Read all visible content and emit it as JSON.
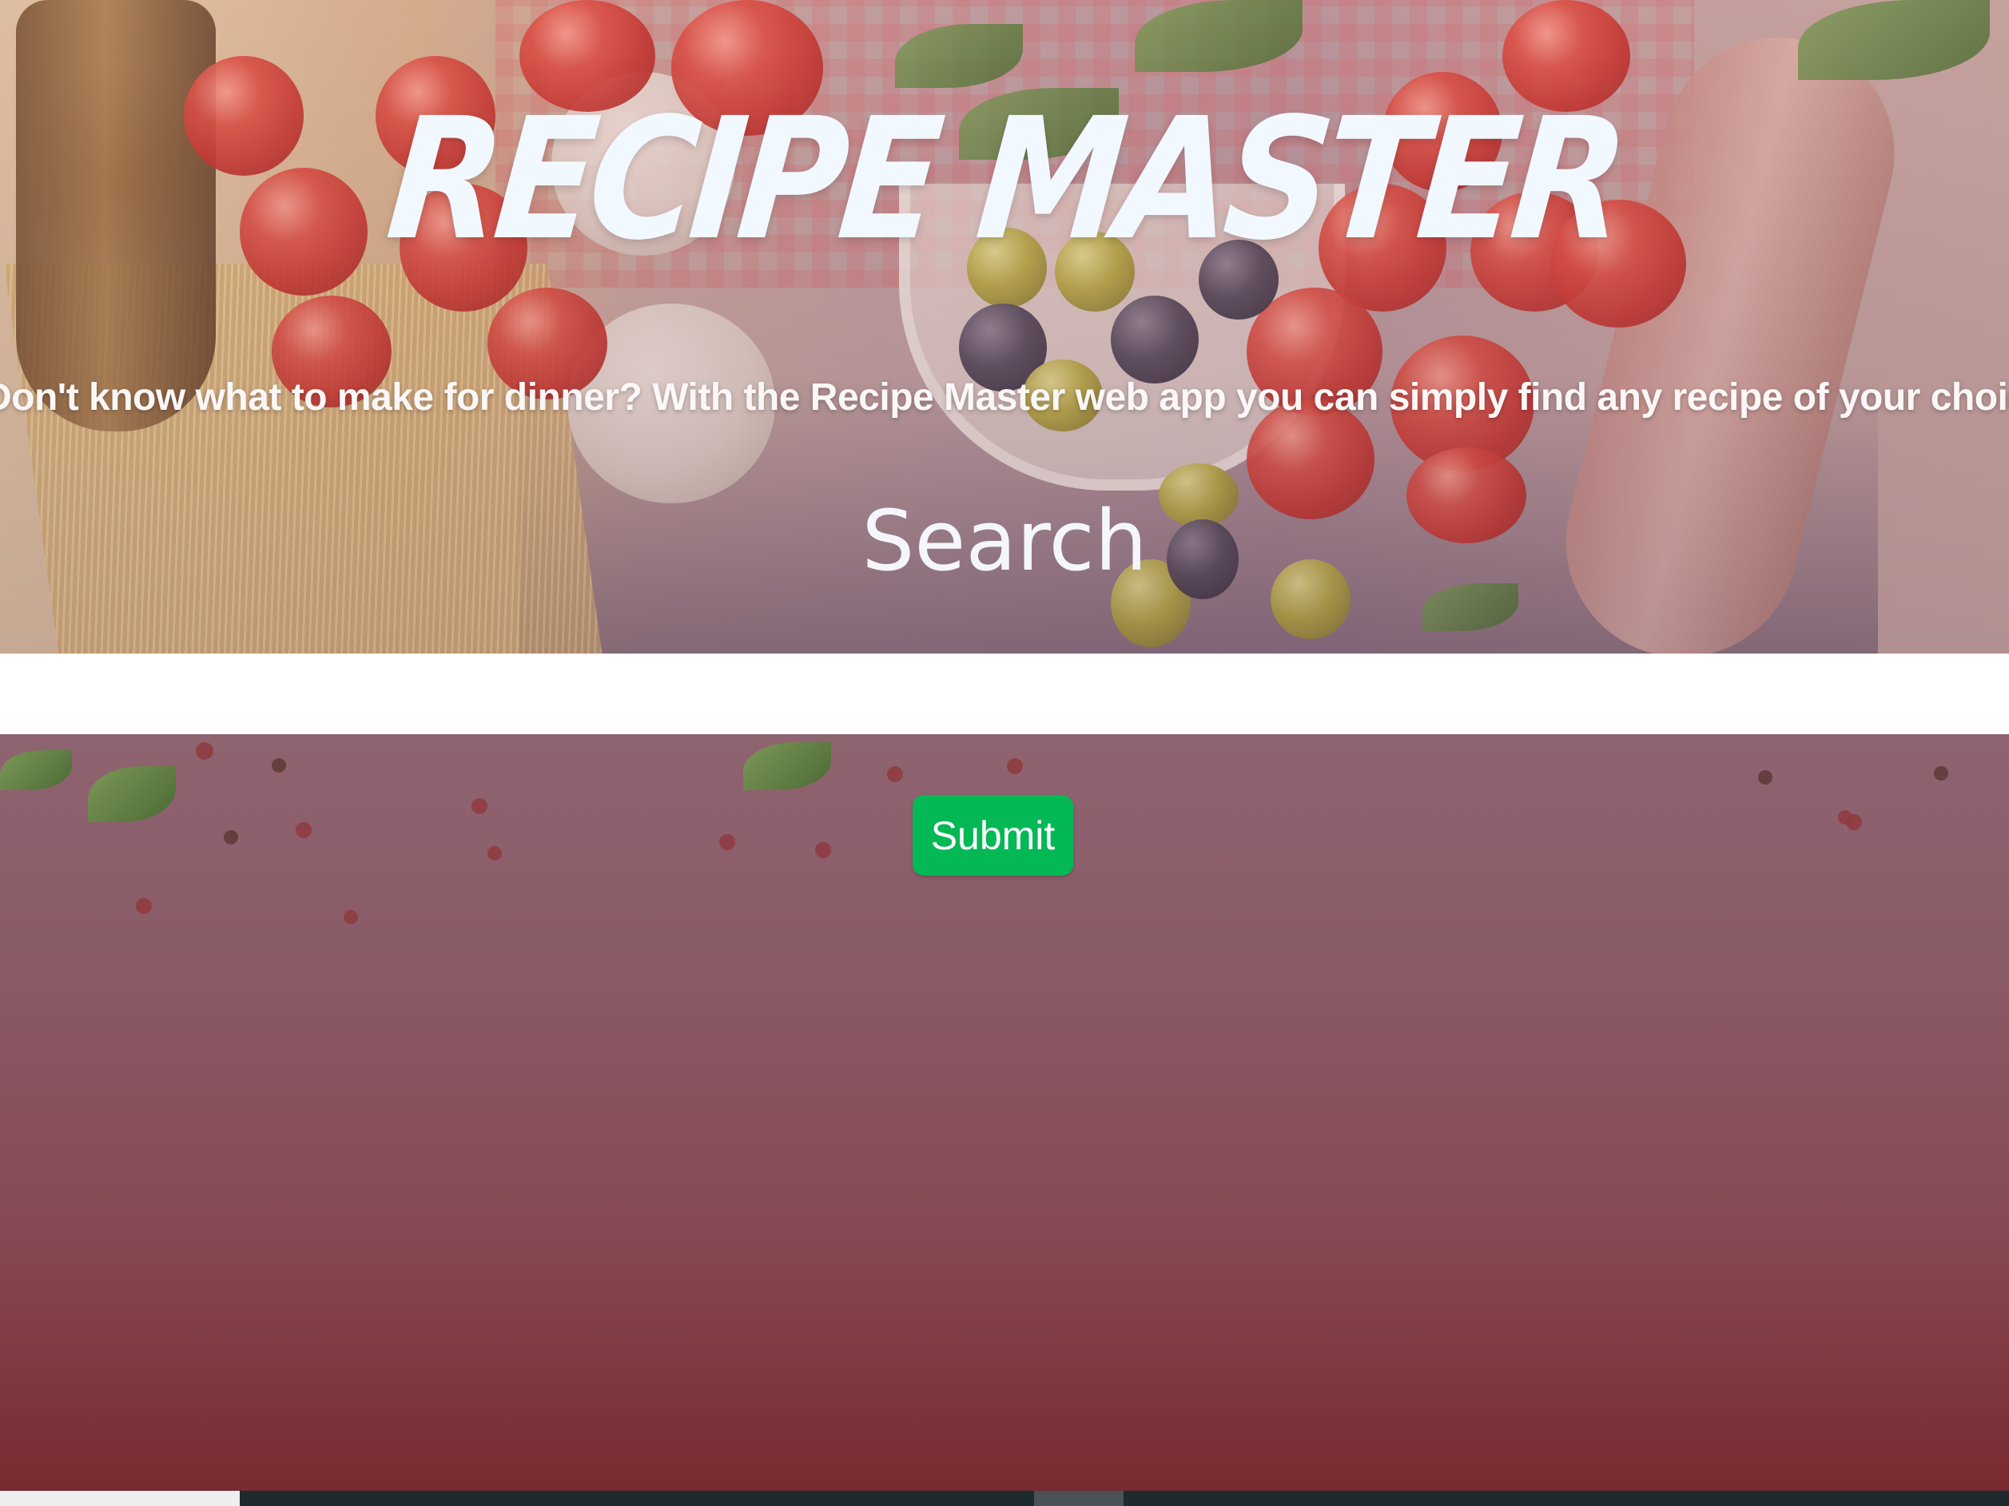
{
  "header": {
    "title": "RECIPE MASTER",
    "tagline": "Don't know what to make for dinner? With the Recipe Master web app you can simply find any recipe of your choice and try it out!"
  },
  "search": {
    "label": "Search",
    "value": "",
    "placeholder": ""
  },
  "actions": {
    "submit_label": "Submit"
  },
  "colors": {
    "submit_button": "#05b856",
    "title_text": "#f2f8ff",
    "lower_background": "#864a54"
  }
}
